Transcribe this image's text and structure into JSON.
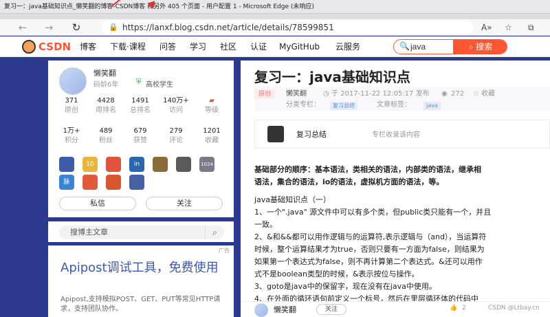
{
  "window": {
    "title": "复习一：java基础知识点_懒笑翻的博客-CSDN博客 和另外 405 个页面 - 用户配置 1 - Microsoft Edge (未响应)"
  },
  "browser": {
    "back": "←",
    "forward": "→",
    "reload": "↻",
    "lock_icon": "🔒",
    "url": "https://lanxf.blog.csdn.net/article/details/78599851",
    "read_aloud": "A»",
    "favorite": "☆",
    "collections": "⧉"
  },
  "csdn_nav": {
    "logo": "CSDN",
    "items": [
      "博客",
      "下载·课程",
      "问答",
      "学习",
      "社区",
      "认证",
      "MyGitHub",
      "云服务"
    ],
    "search_value": "java",
    "search_button": "搜索"
  },
  "profile": {
    "name": "懒笑翻",
    "code_age": "码龄6年",
    "school": "高校学生",
    "shield_icon": "⛨",
    "stats_row1": [
      {
        "value": "371",
        "label": "原创"
      },
      {
        "value": "4428",
        "label": "周排名"
      },
      {
        "value": "1491",
        "label": "总排名"
      },
      {
        "value": "140万+",
        "label": "访问"
      },
      {
        "value": "",
        "label": "等级"
      }
    ],
    "stats_row2": [
      {
        "value": "1万+",
        "label": "积分"
      },
      {
        "value": "489",
        "label": "粉丝"
      },
      {
        "value": "679",
        "label": "获赞"
      },
      {
        "value": "279",
        "label": "评论"
      },
      {
        "value": "1201",
        "label": "收藏"
      }
    ],
    "badges_row1": [
      {
        "text": "",
        "color": "#3e5ca8"
      },
      {
        "text": "10",
        "color": "#e9b53b"
      },
      {
        "text": "",
        "color": "#e0533c"
      },
      {
        "text": "in",
        "color": "#2b67b1"
      },
      {
        "text": "",
        "color": "#8b6a3c"
      },
      {
        "text": "",
        "color": "#5a5a5a"
      },
      {
        "text": "1024",
        "color": "#7a7a88"
      }
    ],
    "badges_row2": [
      {
        "text": "脉",
        "color": "#3b83d6"
      },
      {
        "text": "",
        "color": "#e05a3b"
      },
      {
        "text": "",
        "color": "#d9572f"
      },
      {
        "text": "",
        "color": "#4661a3"
      }
    ],
    "message_button": "私信",
    "follow_button": "关注"
  },
  "sidebar_search": {
    "label": "搜博主文章",
    "icon": "⌕"
  },
  "ad": {
    "tag": "广告",
    "title": "Apipost调试工具，免费使用",
    "desc": "Apipost,支持模拟POST、GET、PUT等常见HTTP请求，支持团队协作。"
  },
  "article": {
    "title": "复习一：java基础知识点",
    "original_tag": "原创",
    "author": "懒笑翻",
    "date": "于 2017-11-22 12:05:17 发布",
    "views": "272",
    "collect": "收藏",
    "column_label": "分类专栏：",
    "column_tag": "复习总结",
    "tags_label": "文章标签：",
    "tag": "java",
    "column_card_name": "复习总结",
    "column_card_desc": "专栏收录该内容",
    "lines": [
      "基础部分的顺序：基本语法，类相关的语法，内部类的语法，继承相",
      "语法，集合的语法，io的语法，虚拟机方面的语法，等。",
      "java基础知识点（一）",
      "1、一个\".java\" 源文件中可以有多个类，但public类只能有一个，并且",
      "一致。",
      "2、&和&&都可以用作逻辑与的运算符,表示逻辑与（and），当运算符",
      "时候，整个运算结果才为true，否则只要有一方面为false，则结果为",
      "如果第一个表达式为false，则不再计算第二个表达式。&还可以用作",
      "式不是boolean类型的时候，&表示按位与操作。",
      "3、goto是java中的保留字，现在没有在java中使用。",
      "4、在外面的循环语句前定义一个标号，然后在里层循环体的代码中"
    ]
  },
  "bottom_bar": {
    "author": "懒笑翻",
    "follow": "关注",
    "likes": "2",
    "watermark": "CSDN @Ltbay.cn"
  }
}
